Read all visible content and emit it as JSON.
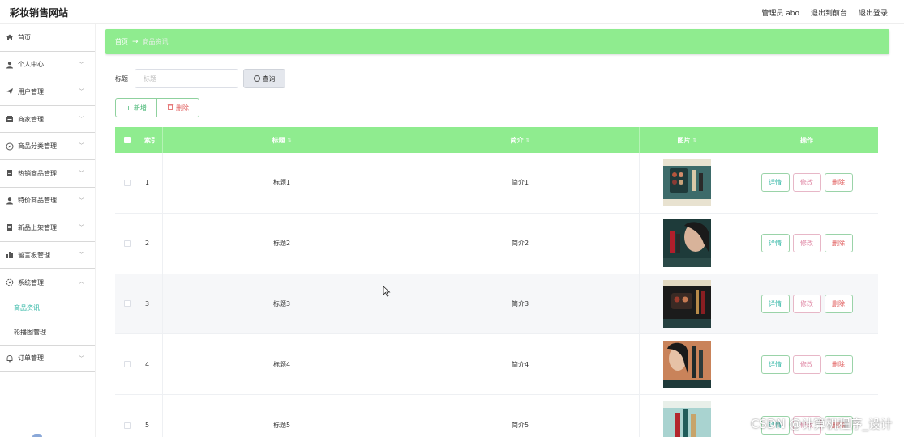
{
  "header": {
    "brand": "彩妆销售网站",
    "admin_label": "管理员 abo",
    "back_to_front": "退出到前台",
    "logout": "退出登录"
  },
  "sidebar": {
    "items": [
      {
        "label": "首页",
        "icon": "home-icon",
        "has_chevron": false
      },
      {
        "label": "个人中心",
        "icon": "user-icon",
        "has_chevron": true
      },
      {
        "label": "用户管理",
        "icon": "send-icon",
        "has_chevron": true
      },
      {
        "label": "商家管理",
        "icon": "shop-icon",
        "has_chevron": true
      },
      {
        "label": "商品分类管理",
        "icon": "compass-icon",
        "has_chevron": true
      },
      {
        "label": "热销商品管理",
        "icon": "document-icon",
        "has_chevron": true
      },
      {
        "label": "特价商品管理",
        "icon": "user-icon",
        "has_chevron": true
      },
      {
        "label": "新品上架管理",
        "icon": "document-icon",
        "has_chevron": true
      },
      {
        "label": "留言板管理",
        "icon": "chart-icon",
        "has_chevron": true
      },
      {
        "label": "系统管理",
        "icon": "settings-icon",
        "has_chevron": true,
        "expanded": true
      }
    ],
    "system_sub": [
      {
        "label": "商品资讯",
        "active": true
      },
      {
        "label": "轮播图管理",
        "active": false
      }
    ],
    "last_item": {
      "label": "订单管理",
      "icon": "bell-icon"
    }
  },
  "breadcrumb": {
    "home": "首页",
    "separator": "→",
    "current": "商品资讯"
  },
  "search": {
    "label": "标题",
    "placeholder": "标题",
    "query_button": "查询"
  },
  "actions": {
    "add": "新增",
    "delete": "删除"
  },
  "table": {
    "headers": {
      "index": "索引",
      "title": "标题",
      "intro": "简介",
      "image": "图片",
      "operation": "操作"
    },
    "rows": [
      {
        "index": "1",
        "title": "标题1",
        "intro": "简介1"
      },
      {
        "index": "2",
        "title": "标题2",
        "intro": "简介2"
      },
      {
        "index": "3",
        "title": "标题3",
        "intro": "简介3"
      },
      {
        "index": "4",
        "title": "标题4",
        "intro": "简介4"
      },
      {
        "index": "5",
        "title": "标题5",
        "intro": "简介5"
      }
    ],
    "op_labels": {
      "detail": "详情",
      "edit": "修改",
      "delete": "删除"
    }
  },
  "watermark": "CSDN @计算机程序_设计",
  "colors": {
    "accent_green": "#8fec8f",
    "active_teal": "#2fb6a4",
    "danger_red": "#e05b5b"
  }
}
